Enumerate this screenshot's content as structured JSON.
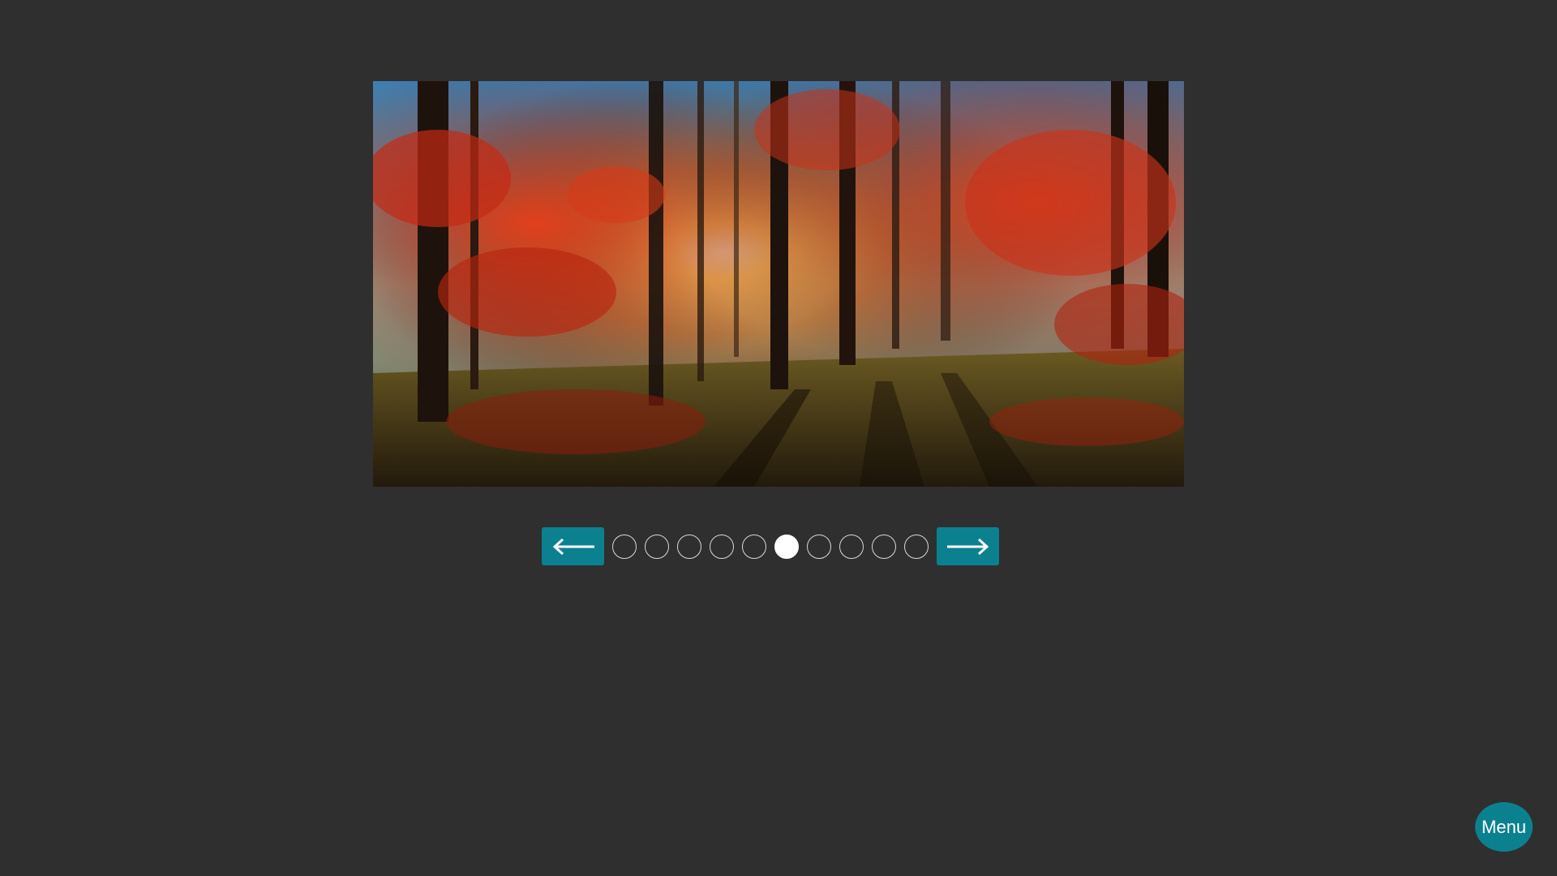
{
  "slider": {
    "image_name": "autumn-forest-image",
    "prev_icon": "arrow-left-icon",
    "next_icon": "arrow-right-icon",
    "slide_count": 10,
    "active_index": 5
  },
  "menu": {
    "label": "Menu"
  },
  "colors": {
    "background": "#2f2f2f",
    "accent": "#0b8190",
    "dot_active": "#ffffff",
    "dot_border": "#d9d9d9"
  }
}
